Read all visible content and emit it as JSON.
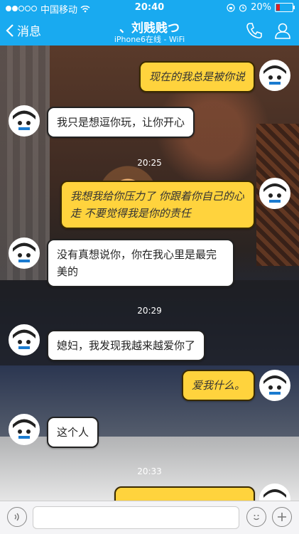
{
  "status": {
    "carrier": "中国移动",
    "time": "20:40",
    "battery": "20%",
    "battery_level": 0.2
  },
  "nav": {
    "back_label": "消息",
    "title": "、刘贱贱つ",
    "subtitle": "iPhone6在线 - WiFi"
  },
  "messages": [
    {
      "from": "me",
      "text": "现在的我总是被你说"
    },
    {
      "from": "other",
      "text": "我只是想逗你玩，让你开心"
    },
    {
      "timestamp": "20:25"
    },
    {
      "from": "me",
      "text": "我想我给你压力了 你跟着你自己的心走 不要觉得我是你的责任"
    },
    {
      "from": "other",
      "text": "没有真想说你，你在我心里是最完美的"
    },
    {
      "timestamp": "20:29"
    },
    {
      "from": "other",
      "text": "媳妇，我发现我越来越爱你了"
    },
    {
      "from": "me",
      "text": "爱我什么。"
    },
    {
      "from": "other",
      "text": "这个人"
    },
    {
      "timestamp": "20:33"
    }
  ],
  "icons": {
    "back": "chevron-left-icon",
    "call": "phone-icon",
    "profile": "person-icon",
    "voice": "voice-icon",
    "emoji": "smiley-icon",
    "plus": "plus-icon"
  },
  "colors": {
    "accent": "#19aaf0",
    "bubble_me": "#ffd33d",
    "bubble_other": "#ffffff"
  }
}
